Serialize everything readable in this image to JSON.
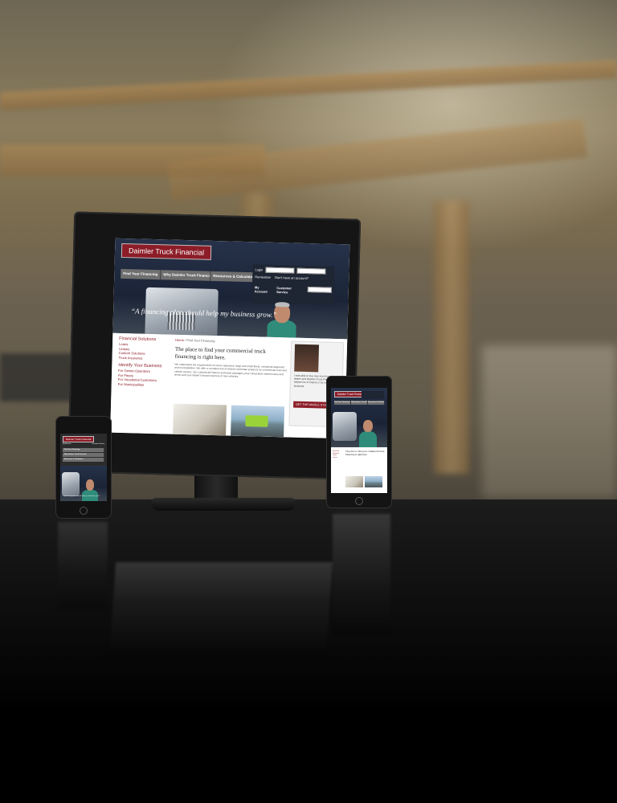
{
  "site": {
    "brand": "Daimler Truck Financial",
    "nav": [
      "Find Your Financing",
      "Why Daimler Truck Financial",
      "Resources & Calculators"
    ],
    "login": {
      "label": "Login",
      "remember_label": "Remember",
      "forgot_label": "Don't have an account?",
      "account_label": "My Account",
      "service_label": "Customer Service"
    },
    "tagline": "“A financing plan should help my business grow.”",
    "breadcrumb_home": "Home",
    "breadcrumb_current": "Find Your Financing",
    "headline": "The place to find your commercial truck financing is right here.",
    "intro": "We understand the requirements of owner-operators, large and small fleets, vocational segments and municipalities. We offer a complete line of finance and lease products for commercial truck and vehicle owners. Our customized finance and lease packages, plus competitive interest rates and terms with your dealer's broad inventory of new vehicles.",
    "sidebar": {
      "section1_title": "Financial Solutions",
      "section1_items": [
        "Loans",
        "Leases",
        "Custom Solutions",
        "Truck Insurance"
      ],
      "section2_title": "Identify Your Business",
      "section2_items": [
        "For Owner-Operators",
        "For Fleets",
        "For Vocational Customers",
        "For Municipalities"
      ]
    },
    "promo": {
      "text": "I was able to buy new truck from the dealer and Daimler Truck Financial helped me to finance it for my business.",
      "button": "GET THE WHOLE STORY"
    }
  },
  "colors": {
    "brand_red": "#8c1d28",
    "hero_navy": "#1b2437",
    "nav_gray": "#6f6f6f"
  }
}
